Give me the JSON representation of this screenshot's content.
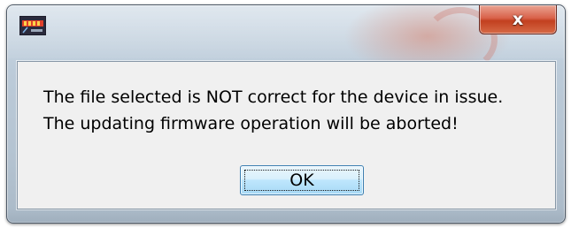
{
  "window": {
    "app_icon": "app-logo-icon",
    "close_icon": "close-icon",
    "close_glyph": "x"
  },
  "dialog": {
    "message_line1": "The file selected is NOT correct for the device in issue.",
    "message_line2": "The updating firmware operation will be aborted!",
    "ok_label": "OK"
  },
  "colors": {
    "close_button": "#c2401f",
    "ok_button_border": "#3c7fb1",
    "client_background": "#f0f0f0",
    "frame": "#bccbd9"
  }
}
